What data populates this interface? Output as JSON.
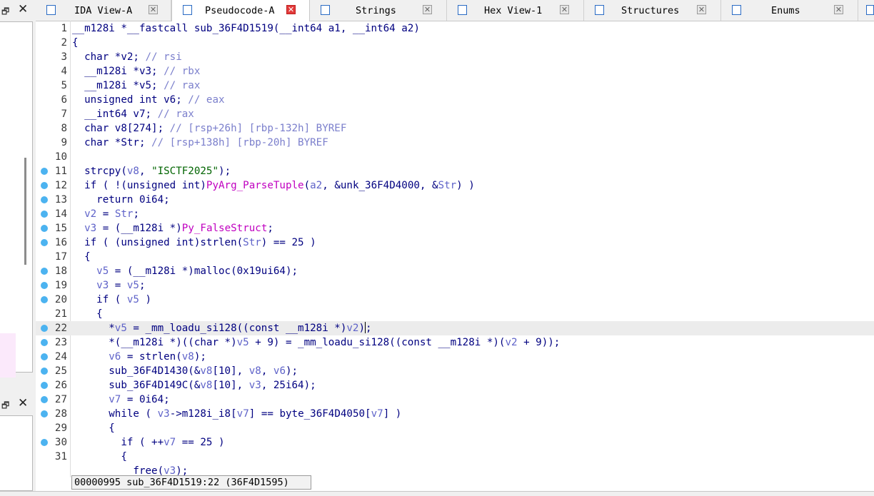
{
  "left_panel": {
    "restore_symbol": "🗗",
    "close_symbol": "✕"
  },
  "tabs": [
    {
      "label": "IDA View-A",
      "icon": "ida-view-icon",
      "active": false,
      "close_symbol": "✕"
    },
    {
      "label": "Pseudocode-A",
      "icon": "pseudocode-icon",
      "active": true,
      "close_symbol": "✕"
    },
    {
      "label": "Strings",
      "icon": "strings-icon",
      "active": false,
      "close_symbol": "✕"
    },
    {
      "label": "Hex View-1",
      "icon": "hex-view-icon",
      "active": false,
      "close_symbol": "✕"
    },
    {
      "label": "Structures",
      "icon": "structures-icon",
      "active": false,
      "close_symbol": "✕"
    },
    {
      "label": "Enums",
      "icon": "enums-icon",
      "active": false,
      "close_symbol": "✕"
    }
  ],
  "colors": {
    "keyword": "#000080",
    "variable": "#5f63c9",
    "comment": "#7b7fcc",
    "string": "#006400",
    "import": "#c000c0",
    "breakpoint": "#4cb3f0",
    "current_line": "#ececec"
  },
  "code": {
    "current_line": 22,
    "lines": [
      {
        "n": "1",
        "bp": false,
        "tokens": [
          [
            "__m128i *__fastcall sub_36F4D1519(__int64 a1, __int64 a2)",
            "k"
          ]
        ]
      },
      {
        "n": "2",
        "bp": false,
        "tokens": [
          [
            "{",
            "k"
          ]
        ]
      },
      {
        "n": "3",
        "bp": false,
        "tokens": [
          [
            "  char *v2; ",
            "k"
          ],
          [
            "// rsi",
            "c"
          ]
        ]
      },
      {
        "n": "4",
        "bp": false,
        "tokens": [
          [
            "  __m128i *v3; ",
            "k"
          ],
          [
            "// rbx",
            "c"
          ]
        ]
      },
      {
        "n": "5",
        "bp": false,
        "tokens": [
          [
            "  __m128i *v5; ",
            "k"
          ],
          [
            "// rax",
            "c"
          ]
        ]
      },
      {
        "n": "6",
        "bp": false,
        "tokens": [
          [
            "  unsigned int v6; ",
            "k"
          ],
          [
            "// eax",
            "c"
          ]
        ]
      },
      {
        "n": "7",
        "bp": false,
        "tokens": [
          [
            "  __int64 v7; ",
            "k"
          ],
          [
            "// rax",
            "c"
          ]
        ]
      },
      {
        "n": "8",
        "bp": false,
        "tokens": [
          [
            "  char v8[274]; ",
            "k"
          ],
          [
            "// [rsp+26h] [rbp-132h] BYREF",
            "c"
          ]
        ]
      },
      {
        "n": "9",
        "bp": false,
        "tokens": [
          [
            "  char *Str; ",
            "k"
          ],
          [
            "// [rsp+138h] [rbp-20h] BYREF",
            "c"
          ]
        ]
      },
      {
        "n": "10",
        "bp": false,
        "tokens": [
          [
            "",
            "k"
          ]
        ]
      },
      {
        "n": "11",
        "bp": true,
        "tokens": [
          [
            "  strcpy(",
            "k"
          ],
          [
            "v8",
            "v"
          ],
          [
            ", ",
            "k"
          ],
          [
            "\"ISCTF2025\"",
            "s"
          ],
          [
            ");",
            "k"
          ]
        ]
      },
      {
        "n": "12",
        "bp": true,
        "tokens": [
          [
            "  if ( !(unsigned int)",
            "k"
          ],
          [
            "PyArg_ParseTuple",
            "i"
          ],
          [
            "(",
            "k"
          ],
          [
            "a2",
            "v"
          ],
          [
            ", &unk_36F4D4000, &",
            "k"
          ],
          [
            "Str",
            "v"
          ],
          [
            ") )",
            "k"
          ]
        ]
      },
      {
        "n": "13",
        "bp": true,
        "tokens": [
          [
            "    return 0i64;",
            "k"
          ]
        ]
      },
      {
        "n": "14",
        "bp": true,
        "tokens": [
          [
            "  ",
            "k"
          ],
          [
            "v2",
            "v"
          ],
          [
            " = ",
            "k"
          ],
          [
            "Str",
            "v"
          ],
          [
            ";",
            "k"
          ]
        ]
      },
      {
        "n": "15",
        "bp": true,
        "tokens": [
          [
            "  ",
            "k"
          ],
          [
            "v3",
            "v"
          ],
          [
            " = (__m128i *)",
            "k"
          ],
          [
            "Py_FalseStruct",
            "i"
          ],
          [
            ";",
            "k"
          ]
        ]
      },
      {
        "n": "16",
        "bp": true,
        "tokens": [
          [
            "  if ( (unsigned int)strlen(",
            "k"
          ],
          [
            "Str",
            "v"
          ],
          [
            ") == 25 )",
            "k"
          ]
        ]
      },
      {
        "n": "17",
        "bp": false,
        "tokens": [
          [
            "  {",
            "k"
          ]
        ]
      },
      {
        "n": "18",
        "bp": true,
        "tokens": [
          [
            "    ",
            "k"
          ],
          [
            "v5",
            "v"
          ],
          [
            " = (__m128i *)malloc(0x19ui64);",
            "k"
          ]
        ]
      },
      {
        "n": "19",
        "bp": true,
        "tokens": [
          [
            "    ",
            "k"
          ],
          [
            "v3",
            "v"
          ],
          [
            " = ",
            "k"
          ],
          [
            "v5",
            "v"
          ],
          [
            ";",
            "k"
          ]
        ]
      },
      {
        "n": "20",
        "bp": true,
        "tokens": [
          [
            "    if ( ",
            "k"
          ],
          [
            "v5",
            "v"
          ],
          [
            " )",
            "k"
          ]
        ]
      },
      {
        "n": "21",
        "bp": false,
        "tokens": [
          [
            "    {",
            "k"
          ]
        ]
      },
      {
        "n": "22",
        "bp": true,
        "tokens": [
          [
            "      *",
            "k"
          ],
          [
            "v5",
            "v"
          ],
          [
            " = _mm_loadu_si128((const __m128i *)",
            "k"
          ],
          [
            "v2",
            "v"
          ],
          [
            ")",
            "k"
          ],
          [
            "|",
            "cursor"
          ],
          [
            ";",
            "k"
          ]
        ]
      },
      {
        "n": "23",
        "bp": true,
        "tokens": [
          [
            "      *(__m128i *)((char *)",
            "k"
          ],
          [
            "v5",
            "v"
          ],
          [
            " + 9) = _mm_loadu_si128((const __m128i *)(",
            "k"
          ],
          [
            "v2",
            "v"
          ],
          [
            " + 9));",
            "k"
          ]
        ]
      },
      {
        "n": "24",
        "bp": true,
        "tokens": [
          [
            "      ",
            "k"
          ],
          [
            "v6",
            "v"
          ],
          [
            " = strlen(",
            "k"
          ],
          [
            "v8",
            "v"
          ],
          [
            ");",
            "k"
          ]
        ]
      },
      {
        "n": "25",
        "bp": true,
        "tokens": [
          [
            "      sub_36F4D1430(&",
            "k"
          ],
          [
            "v8",
            "v"
          ],
          [
            "[10], ",
            "k"
          ],
          [
            "v8",
            "v"
          ],
          [
            ", ",
            "k"
          ],
          [
            "v6",
            "v"
          ],
          [
            ");",
            "k"
          ]
        ]
      },
      {
        "n": "26",
        "bp": true,
        "tokens": [
          [
            "      sub_36F4D149C(&",
            "k"
          ],
          [
            "v8",
            "v"
          ],
          [
            "[10], ",
            "k"
          ],
          [
            "v3",
            "v"
          ],
          [
            ", 25i64);",
            "k"
          ]
        ]
      },
      {
        "n": "27",
        "bp": true,
        "tokens": [
          [
            "      ",
            "k"
          ],
          [
            "v7",
            "v"
          ],
          [
            " = 0i64;",
            "k"
          ]
        ]
      },
      {
        "n": "28",
        "bp": true,
        "tokens": [
          [
            "      while ( ",
            "k"
          ],
          [
            "v3",
            "v"
          ],
          [
            "->m128i_i8[",
            "k"
          ],
          [
            "v7",
            "v"
          ],
          [
            "] == byte_36F4D4050[",
            "k"
          ],
          [
            "v7",
            "v"
          ],
          [
            "] )",
            "k"
          ]
        ]
      },
      {
        "n": "29",
        "bp": false,
        "tokens": [
          [
            "      {",
            "k"
          ]
        ]
      },
      {
        "n": "30",
        "bp": true,
        "tokens": [
          [
            "        if ( ++",
            "k"
          ],
          [
            "v7",
            "v"
          ],
          [
            " == 25 )",
            "k"
          ]
        ]
      },
      {
        "n": "31",
        "bp": false,
        "tokens": [
          [
            "        {",
            "k"
          ]
        ]
      },
      {
        "n": "",
        "bp": false,
        "tokens": [
          [
            "          free(",
            "k"
          ],
          [
            "v3",
            "v"
          ],
          [
            ");",
            "k"
          ]
        ]
      }
    ]
  },
  "status_bar": {
    "text": "00000995 sub_36F4D1519:22 (36F4D1595)"
  }
}
